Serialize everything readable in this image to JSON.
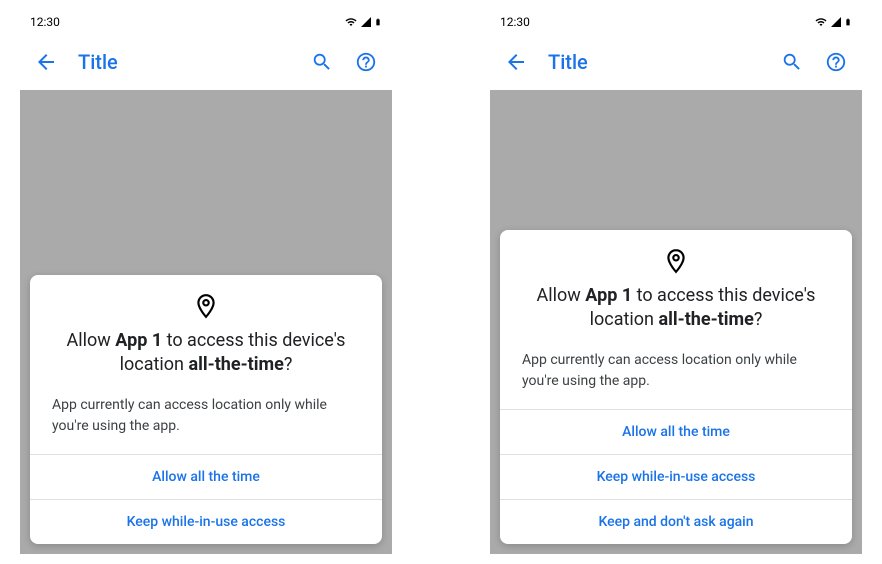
{
  "statusbar": {
    "time": "12:30"
  },
  "appbar": {
    "title": "Title"
  },
  "dialog": {
    "title_prefix": "Allow ",
    "app_name": "App 1",
    "title_mid": " to access this device's location ",
    "title_mode": "all-the-time",
    "title_suffix": "?",
    "body": "App currently can access location only while you're using the app."
  },
  "left_buttons": [
    "Allow all the time",
    "Keep while-in-use access"
  ],
  "right_buttons": [
    "Allow all the time",
    "Keep while-in-use access",
    "Keep and don't ask again"
  ]
}
